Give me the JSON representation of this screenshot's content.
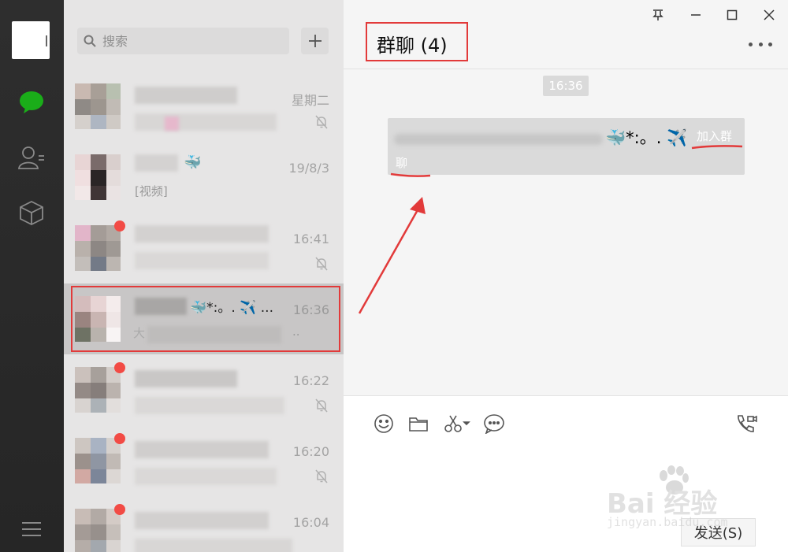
{
  "search": {
    "placeholder": "搜索"
  },
  "chat_list": [
    {
      "time": "星期二",
      "muted": true,
      "unread": false,
      "preview": "",
      "active": false
    },
    {
      "time": "19/8/3",
      "muted": false,
      "unread": false,
      "preview": "[视频]",
      "active": false
    },
    {
      "time": "16:41",
      "muted": true,
      "unread": true,
      "preview": "",
      "active": false
    },
    {
      "time": "16:36",
      "muted": false,
      "unread": false,
      "name_suffix": "🐳*:。. ✈️ ...",
      "preview": "大",
      "preview_end": "..",
      "active": true
    },
    {
      "time": "16:22",
      "muted": true,
      "unread": true,
      "preview": "",
      "active": false
    },
    {
      "time": "16:20",
      "muted": true,
      "unread": true,
      "preview": "",
      "active": false
    },
    {
      "time": "16:04",
      "muted": true,
      "unread": true,
      "preview": "",
      "active": false
    }
  ],
  "chat": {
    "title": "群聊 (4)",
    "timestamp": "16:36",
    "system_message": {
      "emoji": "🐳*:。. ✈️",
      "join_text": "加入群",
      "join_text2": "聊"
    },
    "send_label": "发送(S)"
  },
  "watermark": {
    "main": "Bai 经验",
    "sub": "jingyan.baidu.com"
  },
  "colors": {
    "rail": "#2e2e2e",
    "list": "#e6e5e5",
    "active_row": "#c8c6c6",
    "annotation_red": "#e23a3a",
    "wechat_green": "#1aad19",
    "badge_red": "#f24b45"
  },
  "icons": {
    "rail": [
      "chat-icon",
      "contacts-icon",
      "collection-icon",
      "menu-icon"
    ],
    "toolbar": [
      "emoji-icon",
      "folder-icon",
      "scissors-icon",
      "chat-history-icon",
      "video-call-icon"
    ]
  }
}
